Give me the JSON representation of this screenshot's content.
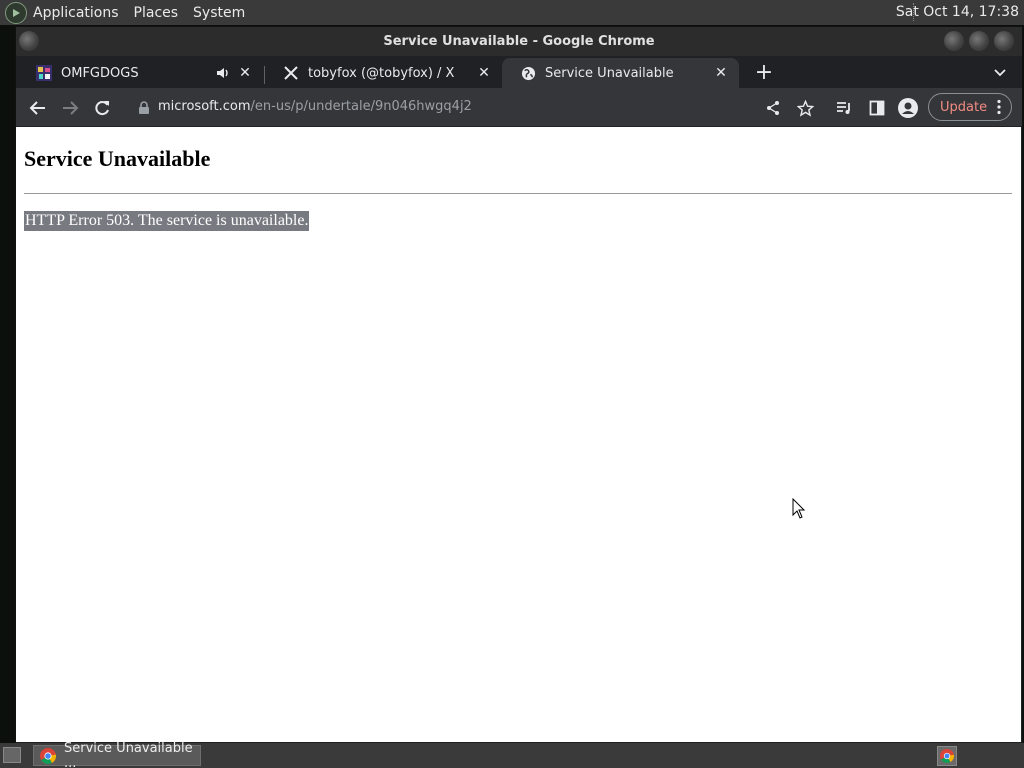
{
  "top_panel": {
    "menus": [
      "Applications",
      "Places",
      "System"
    ],
    "clock": "Sat Oct 14, 17:38"
  },
  "window": {
    "title": "Service Unavailable - Google Chrome"
  },
  "tabs": [
    {
      "title": "OMFGDOGS",
      "favicon": "omfgdogs-icon",
      "audio": true
    },
    {
      "title": "tobyfox (@tobyfox) / X",
      "favicon": "x-logo-icon",
      "audio": false
    },
    {
      "title": "Service Unavailable",
      "favicon": "globe-icon",
      "audio": false,
      "active": true
    }
  ],
  "toolbar": {
    "url_host": "microsoft.com",
    "url_path": "/en-us/p/undertale/9n046hwgq4j2",
    "update_label": "Update"
  },
  "page": {
    "heading": "Service Unavailable",
    "message": "HTTP Error 503. The service is unavailable."
  },
  "taskbar": {
    "task_label": "Service Unavailable ..."
  },
  "colors": {
    "update_text": "#f28b82",
    "page_bg": "#ffffff",
    "selection_bg": "#777a80"
  }
}
